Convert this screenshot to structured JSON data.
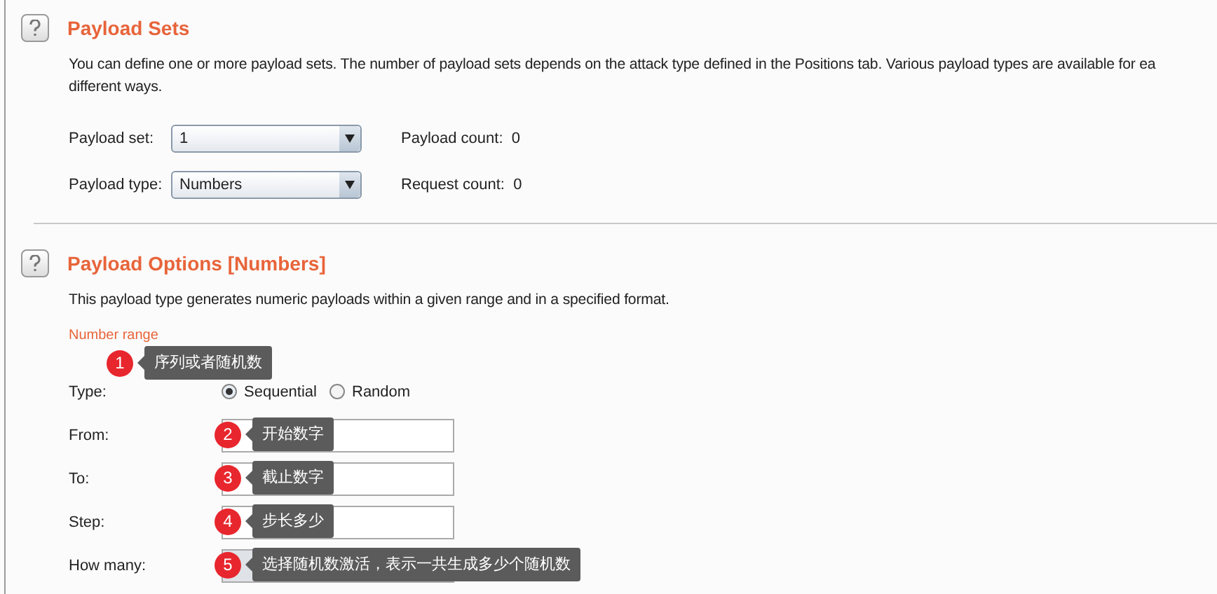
{
  "sections": [
    {
      "title": "Payload Sets",
      "description": [
        "You can define one or more payload sets. The number of payload sets depends on the attack type defined in the Positions tab. Various payload types are available for ea",
        "different ways."
      ],
      "rows": [
        {
          "label": "Payload set:",
          "value": "1",
          "info_label": "Payload count:",
          "info_value": "0"
        },
        {
          "label": "Payload type:",
          "value": "Numbers",
          "info_label": "Request count:",
          "info_value": "0"
        }
      ]
    },
    {
      "title": "Payload Options [Numbers]",
      "description": [
        "This payload type generates numeric payloads within a given range and in a specified format."
      ],
      "group_title": "Number range",
      "fields": [
        {
          "kind": "radio",
          "label": "Type:",
          "options": [
            {
              "label": "Sequential",
              "selected": true
            },
            {
              "label": "Random",
              "selected": false
            }
          ]
        },
        {
          "kind": "text",
          "label": "From:",
          "disabled": false
        },
        {
          "kind": "text",
          "label": "To:",
          "disabled": false
        },
        {
          "kind": "text",
          "label": "Step:",
          "disabled": false
        },
        {
          "kind": "text",
          "label": "How many:",
          "disabled": true
        }
      ]
    }
  ],
  "callouts": [
    {
      "number": "1",
      "text": "序列或者随机数"
    },
    {
      "number": "2",
      "text": "开始数字"
    },
    {
      "number": "3",
      "text": "截止数字"
    },
    {
      "number": "4",
      "text": "步长多少"
    },
    {
      "number": "5",
      "text": "选择随机数激活，表示一共生成多少个随机数"
    }
  ]
}
